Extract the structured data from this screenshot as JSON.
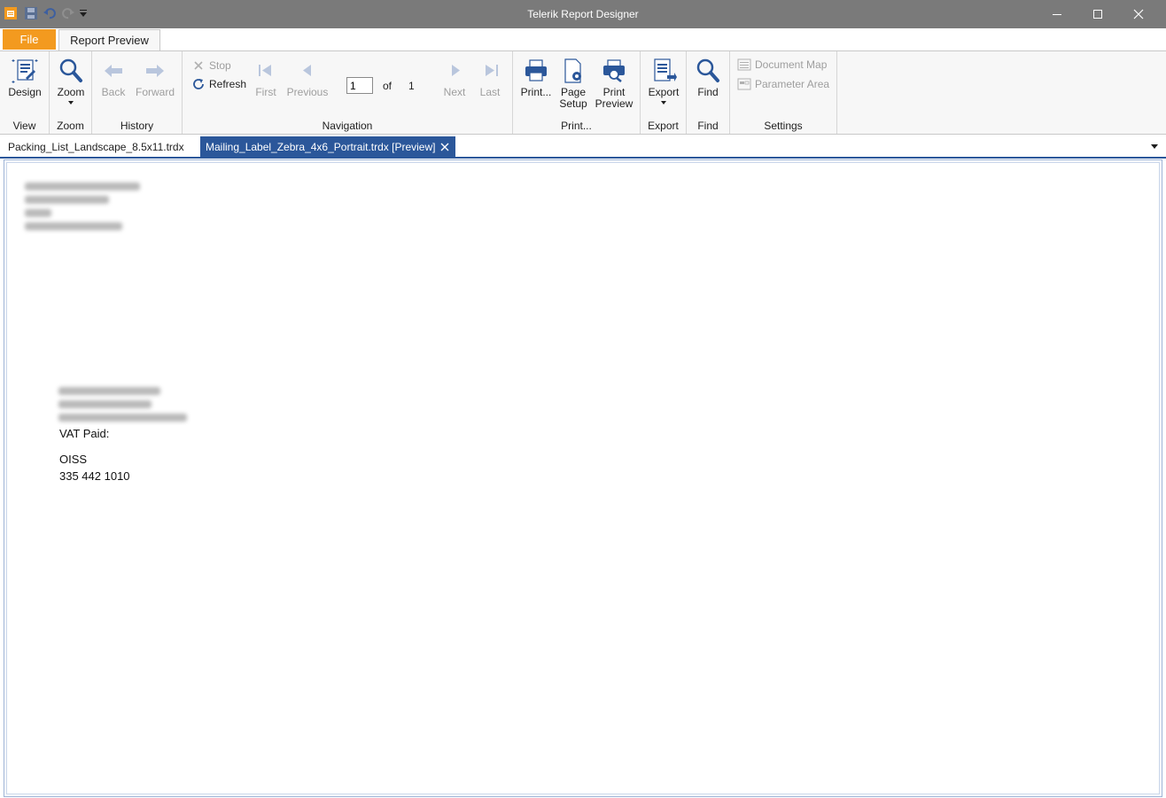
{
  "window": {
    "title": "Telerik Report Designer"
  },
  "menu": {
    "file_label": "File",
    "ribbon_tab_label": "Report Preview"
  },
  "ribbon": {
    "view": {
      "group_label": "View",
      "design_label": "Design"
    },
    "zoom": {
      "group_label": "Zoom",
      "zoom_label": "Zoom"
    },
    "history": {
      "group_label": "History",
      "back_label": "Back",
      "forward_label": "Forward"
    },
    "navigation": {
      "group_label": "Navigation",
      "stop_label": "Stop",
      "refresh_label": "Refresh",
      "first_label": "First",
      "previous_label": "Previous",
      "current_page": "1",
      "of_label": "of",
      "total_pages": "1",
      "next_label": "Next",
      "last_label": "Last"
    },
    "print": {
      "group_label": "Print...",
      "print_label": "Print...",
      "page_setup_line1": "Page",
      "page_setup_line2": "Setup",
      "print_preview_line1": "Print",
      "print_preview_line2": "Preview"
    },
    "export": {
      "group_label": "Export",
      "export_label": "Export"
    },
    "find": {
      "group_label": "Find",
      "find_label": "Find"
    },
    "settings": {
      "group_label": "Settings",
      "document_map_label": "Document Map",
      "parameter_area_label": "Parameter Area"
    }
  },
  "document_tabs": [
    {
      "label": "Packing_List_Landscape_8.5x11.trdx",
      "active": false
    },
    {
      "label": "Mailing_Label_Zebra_4x6_Portrait.trdx [Preview]",
      "active": true
    }
  ],
  "report": {
    "vat_label": "VAT Paid:",
    "company": "OISS",
    "phone": "335 442 1010"
  },
  "colors": {
    "title_bar": "#7a7a7a",
    "file_tab": "#f39a1f",
    "active_doc_tab": "#2b579a",
    "icon_blue": "#2b579a"
  }
}
